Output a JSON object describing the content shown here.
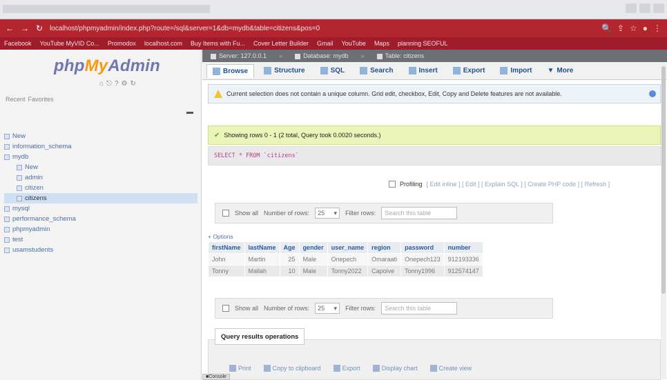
{
  "browser": {
    "url": "localhost/phpmyadmin/index.php?route=/sql&server=1&db=mydb&table=citizens&pos=0",
    "bookmarks": [
      "Facebook",
      "YouTube MyVID Co...",
      "Promodox",
      "localhost.com",
      "Buy Items with Fu...",
      "Cover Letter Builder",
      "Gmail",
      "YouTube",
      "Maps",
      "planning SEOFUL"
    ]
  },
  "sidebar": {
    "logo_php": "php",
    "logo_my": "My",
    "logo_admin": "Admin",
    "tabs": [
      "Recent",
      "Favorites"
    ],
    "tree": [
      {
        "label": "New",
        "level": 0
      },
      {
        "label": "information_schema",
        "level": 0
      },
      {
        "label": "mydb",
        "level": 0
      },
      {
        "label": "New",
        "level": 1
      },
      {
        "label": "admin",
        "level": 1
      },
      {
        "label": "citizen",
        "level": 1
      },
      {
        "label": "citizens",
        "level": 1
      },
      {
        "label": "mysql",
        "level": 0
      },
      {
        "label": "performance_schema",
        "level": 0
      },
      {
        "label": "phpmyadmin",
        "level": 0
      },
      {
        "label": "test",
        "level": 0
      },
      {
        "label": "usamstudents",
        "level": 0
      }
    ]
  },
  "breadcrumbs": {
    "server": "Server: 127.0.0.1",
    "database": "Database: mydb",
    "table": "Table: citizens"
  },
  "tabs": {
    "browse": "Browse",
    "structure": "Structure",
    "sql": "SQL",
    "search": "Search",
    "insert": "Insert",
    "export": "Export",
    "import": "Import",
    "more": "More"
  },
  "notice": "Current selection does not contain a unique column. Grid edit, checkbox, Edit, Copy and Delete features are not available.",
  "success": "Showing rows 0 - 1 (2 total, Query took 0.0020 seconds.)",
  "sql_query": "SELECT * FROM `citizens`",
  "profiling": {
    "label": "Profiling",
    "links": "[ Edit inline ] [ Edit ] [ Explain SQL ] [ Create PHP code ] [ Refresh ]"
  },
  "table_nav": {
    "show_all": "Show all",
    "rows_label": "Number of rows:",
    "rows_value": "25",
    "filter_label": "Filter rows:",
    "filter_placeholder": "Search this table"
  },
  "options_link": "+ Options",
  "results": {
    "columns": [
      "firstName",
      "lastName",
      "Age",
      "gender",
      "user_name",
      "region",
      "password",
      "number"
    ],
    "rows": [
      [
        "John",
        "Martin",
        "25",
        "Male",
        "Onepech",
        "Omaraati",
        "Onepech123",
        "912193336"
      ],
      [
        "Tonny",
        "Mallah",
        "10",
        "Male",
        "Tonny2022",
        "Capoive",
        "Tonny1996",
        "912574147"
      ]
    ]
  },
  "query_ops": {
    "title": "Query results operations",
    "print": "Print",
    "copy": "Copy to clipboard",
    "export": "Export",
    "chart": "Display chart",
    "view": "Create view"
  },
  "console": "Console"
}
